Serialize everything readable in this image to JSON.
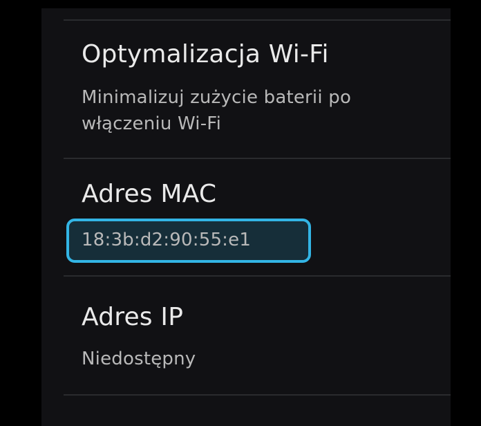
{
  "settings": {
    "wifi_optimization": {
      "title": "Optymalizacja Wi-Fi",
      "summary": "Minimalizuj zużycie baterii po włączeniu Wi-Fi"
    },
    "mac_address": {
      "title": "Adres MAC",
      "value": "18:3b:d2:90:55:e1"
    },
    "ip_address": {
      "title": "Adres IP",
      "value": "Niedostępny"
    }
  },
  "colors": {
    "highlight": "#33b5e5",
    "background": "#111114",
    "title_text": "#eaeaea",
    "summary_text": "#b9b9b9"
  }
}
